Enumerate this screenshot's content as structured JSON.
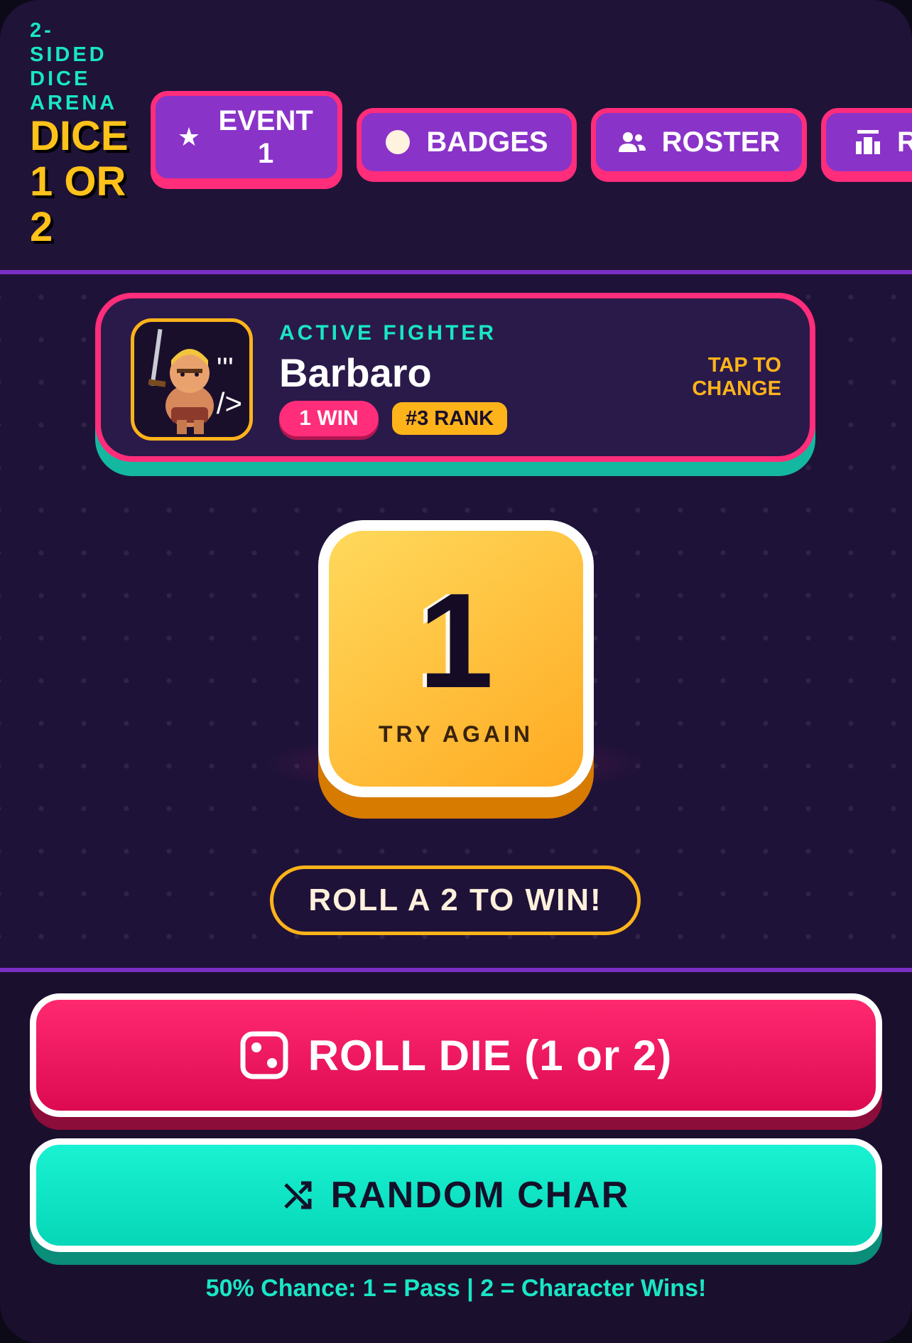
{
  "header": {
    "subtitle": "2-\nSIDED\nDICE\nARENA",
    "title": "DICE 1 OR 2",
    "nav": [
      {
        "label": "EVENT 1",
        "icon": "star-icon"
      },
      {
        "label": "BADGES",
        "icon": "circle-icon"
      },
      {
        "label": "ROSTER",
        "icon": "users-icon"
      },
      {
        "label": "R",
        "icon": "podium-icon"
      }
    ]
  },
  "fighter": {
    "section_label": "ACTIVE FIGHTER",
    "name": "Barbaro",
    "wins": "1 WIN",
    "rank": "#3 RANK",
    "change_label": "TAP TO CHANGE",
    "avatar_overlay": "'''\n/>"
  },
  "die": {
    "value": "1",
    "status": "TRY AGAIN"
  },
  "goal": "ROLL A 2 TO WIN!",
  "actions": {
    "roll_label": "ROLL DIE (1 or 2)",
    "random_label": "RANDOM CHAR"
  },
  "footer_hint": "50% Chance: 1 = Pass | 2 = Character Wins!",
  "colors": {
    "accent_pink": "#ff2d7a",
    "accent_teal": "#19e6c4",
    "accent_gold": "#ffb31a",
    "accent_purple": "#8a33c8",
    "background": "#1f1239"
  }
}
